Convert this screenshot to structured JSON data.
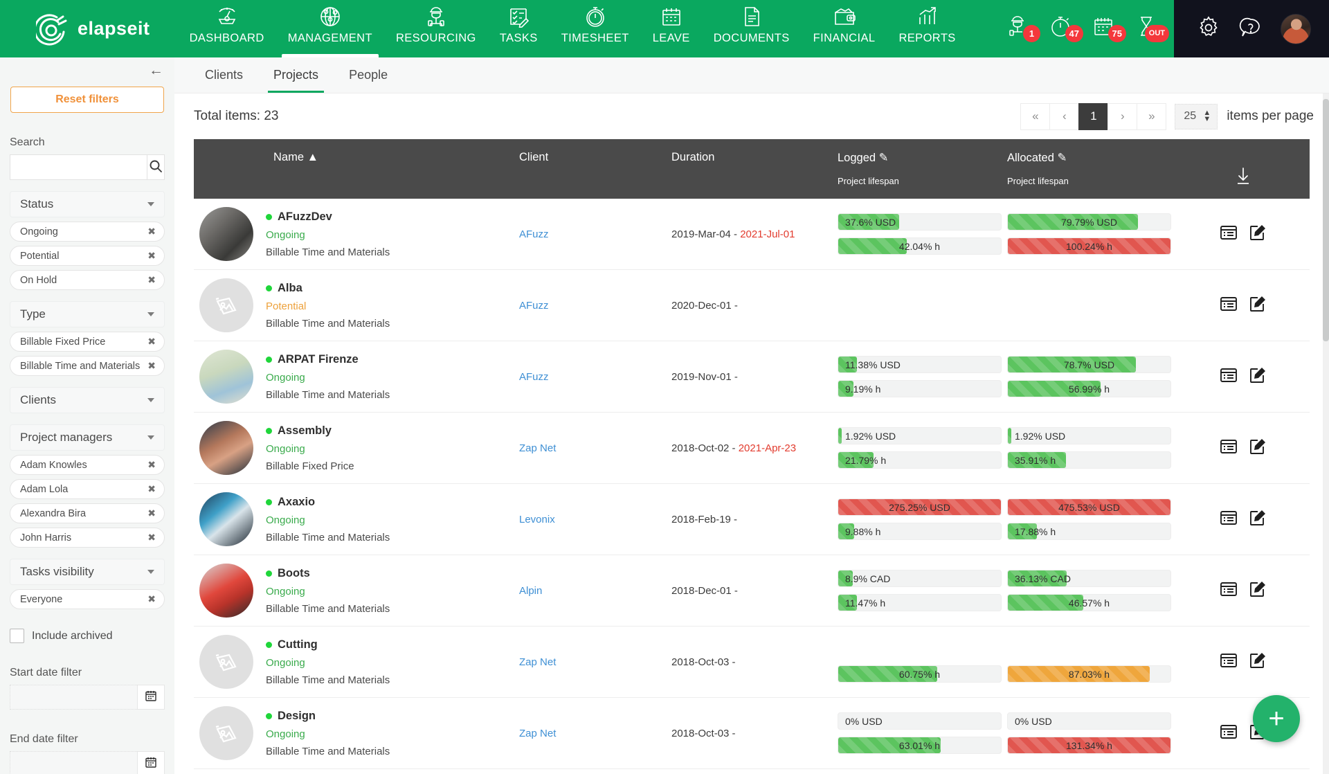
{
  "brand": {
    "name": "elapseit"
  },
  "nav": {
    "items": [
      {
        "label": "DASHBOARD",
        "icon": "gauge-icon",
        "active": false
      },
      {
        "label": "MANAGEMENT",
        "icon": "globe-icon",
        "active": true
      },
      {
        "label": "RESOURCING",
        "icon": "worker-icon",
        "active": false
      },
      {
        "label": "TASKS",
        "icon": "checklist-icon",
        "active": false
      },
      {
        "label": "TIMESHEET",
        "icon": "stopwatch-icon",
        "active": false
      },
      {
        "label": "LEAVE",
        "icon": "calendar-icon",
        "active": false
      },
      {
        "label": "DOCUMENTS",
        "icon": "document-icon",
        "active": false
      },
      {
        "label": "FINANCIAL",
        "icon": "wallet-icon",
        "active": false
      },
      {
        "label": "REPORTS",
        "icon": "bar-chart-icon",
        "active": false
      }
    ],
    "quick": [
      {
        "icon": "worker-badge-icon",
        "badge": "1"
      },
      {
        "icon": "stopwatch-badge-icon",
        "badge": "47"
      },
      {
        "icon": "calendar-badge-icon",
        "badge": "75"
      },
      {
        "icon": "hourglass-badge-icon",
        "badge": "OUT"
      }
    ],
    "settings_icon": "gear-icon",
    "help_icon": "help-icon",
    "avatar": "user-avatar"
  },
  "sidebar": {
    "collapse_label": "←",
    "reset_label": "Reset filters",
    "search_label": "Search",
    "search_value": "",
    "search_placeholder": "",
    "groups": [
      {
        "label": "Status",
        "chips": [
          "Ongoing",
          "Potential",
          "On Hold"
        ]
      },
      {
        "label": "Type",
        "chips": [
          "Billable Fixed Price",
          "Billable Time and Materials"
        ]
      },
      {
        "label": "Clients",
        "chips": []
      },
      {
        "label": "Project managers",
        "chips": [
          "Adam Knowles",
          "Adam Lola",
          "Alexandra Bira",
          "John Harris"
        ]
      },
      {
        "label": "Tasks visibility",
        "chips": [
          "Everyone"
        ]
      }
    ],
    "include_archived_label": "Include archived",
    "include_archived_checked": false,
    "start_date_label": "Start date filter",
    "start_date_value": "",
    "end_date_label": "End date filter",
    "end_date_value": ""
  },
  "tabs": [
    {
      "label": "Clients",
      "active": false
    },
    {
      "label": "Projects",
      "active": true
    },
    {
      "label": "People",
      "active": false
    }
  ],
  "toolbar": {
    "total_items": "Total items: 23",
    "pager": {
      "first": "«",
      "prev": "‹",
      "current": "1",
      "next": "›",
      "last": "»"
    },
    "items_per_page_value": "25",
    "items_per_page_label": "items per page"
  },
  "table": {
    "headers": {
      "name": "Name",
      "sort_indicator": "▲",
      "client": "Client",
      "duration": "Duration",
      "logged": "Logged",
      "logged_sub": "Project lifespan",
      "allocated": "Allocated",
      "allocated_sub": "Project lifespan",
      "download_icon": "download-icon",
      "edit_icon": "pencil-icon"
    },
    "rows": [
      {
        "name": "AFuzzDev",
        "status": "Ongoing",
        "status_color": "#3aab4c",
        "type": "Billable Time and Materials",
        "thumb": "photo",
        "client": "AFuzz",
        "duration_start": "2019-Mar-04 - ",
        "duration_end": "2021-Jul-01",
        "logged_money": {
          "text": "37.6% USD",
          "pct": 37.6,
          "color": "green",
          "align": "left"
        },
        "logged_hours": {
          "text": "42.04% h",
          "pct": 42.04,
          "color": "green",
          "align": "center"
        },
        "alloc_money": {
          "text": "79.79% USD",
          "pct": 79.79,
          "color": "green",
          "align": "center"
        },
        "alloc_hours": {
          "text": "100.24% h",
          "pct": 100,
          "color": "red",
          "align": "center"
        }
      },
      {
        "name": "Alba",
        "status": "Potential",
        "status_color": "#eda13b",
        "type": "Billable Time and Materials",
        "thumb": "placeholder",
        "client": "AFuzz",
        "duration_start": "2020-Dec-01 - ",
        "duration_end": "",
        "logged_money": null,
        "logged_hours": null,
        "alloc_money": null,
        "alloc_hours": null
      },
      {
        "name": "ARPAT Firenze",
        "status": "Ongoing",
        "status_color": "#3aab4c",
        "type": "Billable Time and Materials",
        "thumb": "map",
        "client": "AFuzz",
        "duration_start": "2019-Nov-01 - ",
        "duration_end": "",
        "logged_money": {
          "text": "11.38% USD",
          "pct": 11.38,
          "color": "green",
          "align": "left"
        },
        "logged_hours": {
          "text": "9.19% h",
          "pct": 9.19,
          "color": "green",
          "align": "left"
        },
        "alloc_money": {
          "text": "78.7% USD",
          "pct": 78.7,
          "color": "green",
          "align": "center"
        },
        "alloc_hours": {
          "text": "56.99% h",
          "pct": 56.99,
          "color": "green",
          "align": "center"
        }
      },
      {
        "name": "Assembly",
        "status": "Ongoing",
        "status_color": "#3aab4c",
        "type": "Billable Fixed Price",
        "thumb": "photo2",
        "client": "Zap Net",
        "duration_start": "2018-Oct-02 - ",
        "duration_end": "2021-Apr-23",
        "logged_money": {
          "text": "1.92% USD",
          "pct": 1.92,
          "color": "green",
          "align": "left"
        },
        "logged_hours": {
          "text": "21.79% h",
          "pct": 21.79,
          "color": "green",
          "align": "left"
        },
        "alloc_money": {
          "text": "1.92% USD",
          "pct": 1.92,
          "color": "green",
          "align": "left"
        },
        "alloc_hours": {
          "text": "35.91% h",
          "pct": 35.91,
          "color": "green",
          "align": "left"
        }
      },
      {
        "name": "Axaxio",
        "status": "Ongoing",
        "status_color": "#3aab4c",
        "type": "Billable Time and Materials",
        "thumb": "photo3",
        "client": "Levonix",
        "duration_start": "2018-Feb-19 - ",
        "duration_end": "",
        "logged_money": {
          "text": "275.25% USD",
          "pct": 100,
          "color": "red",
          "align": "center"
        },
        "logged_hours": {
          "text": "9.88% h",
          "pct": 9.88,
          "color": "green",
          "align": "left"
        },
        "alloc_money": {
          "text": "475.53% USD",
          "pct": 100,
          "color": "red",
          "align": "center"
        },
        "alloc_hours": {
          "text": "17.88% h",
          "pct": 17.88,
          "color": "green",
          "align": "left"
        }
      },
      {
        "name": "Boots",
        "status": "Ongoing",
        "status_color": "#3aab4c",
        "type": "Billable Time and Materials",
        "thumb": "photo4",
        "client": "Alpin",
        "duration_start": "2018-Dec-01 - ",
        "duration_end": "",
        "logged_money": {
          "text": "8.9% CAD",
          "pct": 8.9,
          "color": "green",
          "align": "left"
        },
        "logged_hours": {
          "text": "11.47% h",
          "pct": 11.47,
          "color": "green",
          "align": "left"
        },
        "alloc_money": {
          "text": "36.13% CAD",
          "pct": 36.13,
          "color": "green",
          "align": "left"
        },
        "alloc_hours": {
          "text": "46.57% h",
          "pct": 46.57,
          "color": "green",
          "align": "center"
        }
      },
      {
        "name": "Cutting",
        "status": "Ongoing",
        "status_color": "#3aab4c",
        "type": "Billable Time and Materials",
        "thumb": "placeholder",
        "client": "Zap Net",
        "duration_start": "2018-Oct-03 - ",
        "duration_end": "",
        "logged_money": null,
        "logged_hours": {
          "text": "60.75% h",
          "pct": 60.75,
          "color": "green",
          "align": "center"
        },
        "alloc_money": null,
        "alloc_hours": {
          "text": "87.03% h",
          "pct": 87.03,
          "color": "orange",
          "align": "center"
        }
      },
      {
        "name": "Design",
        "status": "Ongoing",
        "status_color": "#3aab4c",
        "type": "Billable Time and Materials",
        "thumb": "placeholder",
        "client": "Zap Net",
        "duration_start": "2018-Oct-03 - ",
        "duration_end": "",
        "logged_money": {
          "text": "0% USD",
          "pct": 0,
          "color": "green",
          "align": "left"
        },
        "logged_hours": {
          "text": "63.01% h",
          "pct": 63.01,
          "color": "green",
          "align": "center"
        },
        "alloc_money": {
          "text": "0% USD",
          "pct": 0,
          "color": "green",
          "align": "left"
        },
        "alloc_hours": {
          "text": "131.34% h",
          "pct": 100,
          "color": "red",
          "align": "center"
        }
      }
    ]
  },
  "fab": {
    "icon": "plus-icon"
  }
}
